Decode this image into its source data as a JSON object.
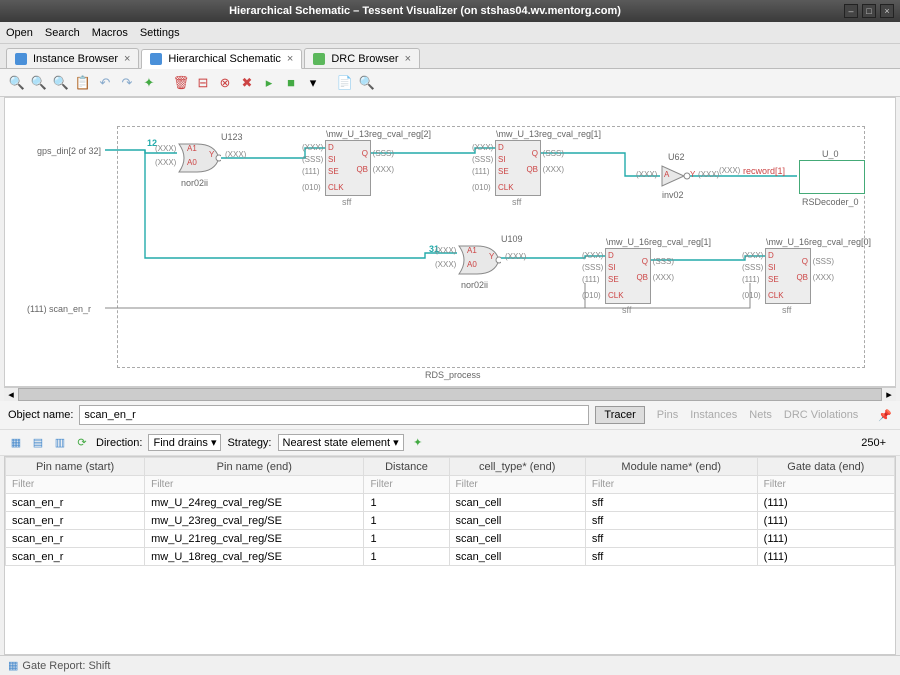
{
  "window": {
    "title": "Hierarchical Schematic – Tessent Visualizer (on stshas04.wv.mentorg.com)"
  },
  "menu": {
    "open": "Open",
    "search": "Search",
    "macros": "Macros",
    "settings": "Settings"
  },
  "tabs": {
    "instance": "Instance Browser",
    "schematic": "Hierarchical Schematic",
    "drc": "DRC Browser"
  },
  "schematic": {
    "boundary_label": "RDS_process",
    "port_gps": "gps_din[2 of 32]",
    "port_scan": "scan_en_r",
    "wirelabel_12": "12",
    "wirelabel_31": "31",
    "ann111": "(111)",
    "annXXX": "(XXX)",
    "annSSS": "(SSS)",
    "ann010": "(010)",
    "u123": {
      "name": "U123",
      "type": "nor02ii",
      "a1": "A1",
      "a0": "A0",
      "y": "Y"
    },
    "u109": {
      "name": "U109",
      "type": "nor02ii",
      "a1": "A1",
      "a0": "A0",
      "y": "Y"
    },
    "u62": {
      "name": "U62",
      "type": "inv02",
      "a": "A",
      "y": "Y"
    },
    "ff_type": "sff",
    "ff1": "\\mw_U_13reg_cval_reg[2]",
    "ff2": "\\mw_U_13reg_cval_reg[1]",
    "ff3": "\\mw_U_16reg_cval_reg[1]",
    "ff4": "\\mw_U_16reg_cval_reg[0]",
    "pin_d": "D",
    "pin_si": "SI",
    "pin_se": "SE",
    "pin_clk": "CLK",
    "pin_q": "Q",
    "pin_qb": "QB",
    "recword": "recword[1]",
    "dec_name": "U_0",
    "dec_type": "RSDecoder_0"
  },
  "object": {
    "label": "Object name:",
    "value": "scan_en_r",
    "tracer": "Tracer",
    "pins": "Pins",
    "instances": "Instances",
    "nets": "Nets",
    "drc": "DRC Violations"
  },
  "dir": {
    "label": "Direction:",
    "direction_value": "Find drains",
    "strategy_label": "Strategy:",
    "strategy_value": "Nearest state element",
    "count": "250+"
  },
  "table": {
    "h1": "Pin name (start)",
    "h2": "Pin name (end)",
    "h3": "Distance",
    "h4": "cell_type* (end)",
    "h5": "Module name* (end)",
    "h6": "Gate data (end)",
    "filter": "Filter",
    "rows": [
      {
        "c1": "scan_en_r",
        "c2": "mw_U_24reg_cval_reg/SE",
        "c3": "1",
        "c4": "scan_cell",
        "c5": "sff",
        "c6": "(111)"
      },
      {
        "c1": "scan_en_r",
        "c2": "mw_U_23reg_cval_reg/SE",
        "c3": "1",
        "c4": "scan_cell",
        "c5": "sff",
        "c6": "(111)"
      },
      {
        "c1": "scan_en_r",
        "c2": "mw_U_21reg_cval_reg/SE",
        "c3": "1",
        "c4": "scan_cell",
        "c5": "sff",
        "c6": "(111)"
      },
      {
        "c1": "scan_en_r",
        "c2": "mw_U_18reg_cval_reg/SE",
        "c3": "1",
        "c4": "scan_cell",
        "c5": "sff",
        "c6": "(111)"
      }
    ]
  },
  "status": {
    "text": "Gate Report: Shift"
  }
}
